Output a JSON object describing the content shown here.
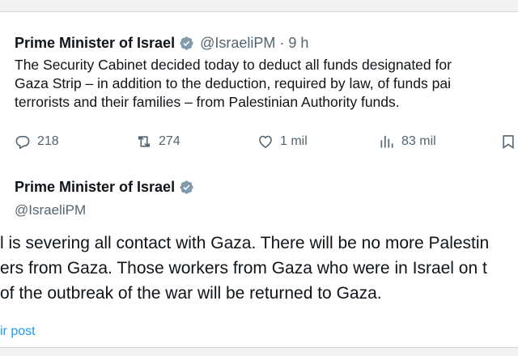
{
  "tweet1": {
    "name": "Prime Minister of Israel",
    "handle": "@IsraeliPM",
    "separator": "·",
    "time": "9 h",
    "text_lines": [
      "The Security Cabinet decided today to deduct all funds designated for",
      "Gaza Strip – in addition to the deduction, required by law, of funds pai",
      "terrorists and their families – from Palestinian Authority funds."
    ],
    "replies": "218",
    "reposts": "274",
    "likes": "1 mil",
    "views": "83 mil"
  },
  "tweet2": {
    "name": "Prime Minister of Israel",
    "handle": "@IsraeliPM",
    "text_lines": [
      "l is severing all contact with Gaza. There will be no more Palestin",
      "ers from Gaza. Those workers from Gaza who were in Israel on t",
      "of the outbreak of the war will be returned to Gaza."
    ],
    "link": "ir post"
  },
  "colors": {
    "verified": "#829aab",
    "muted": "#536471",
    "link": "#1d9bf0"
  }
}
